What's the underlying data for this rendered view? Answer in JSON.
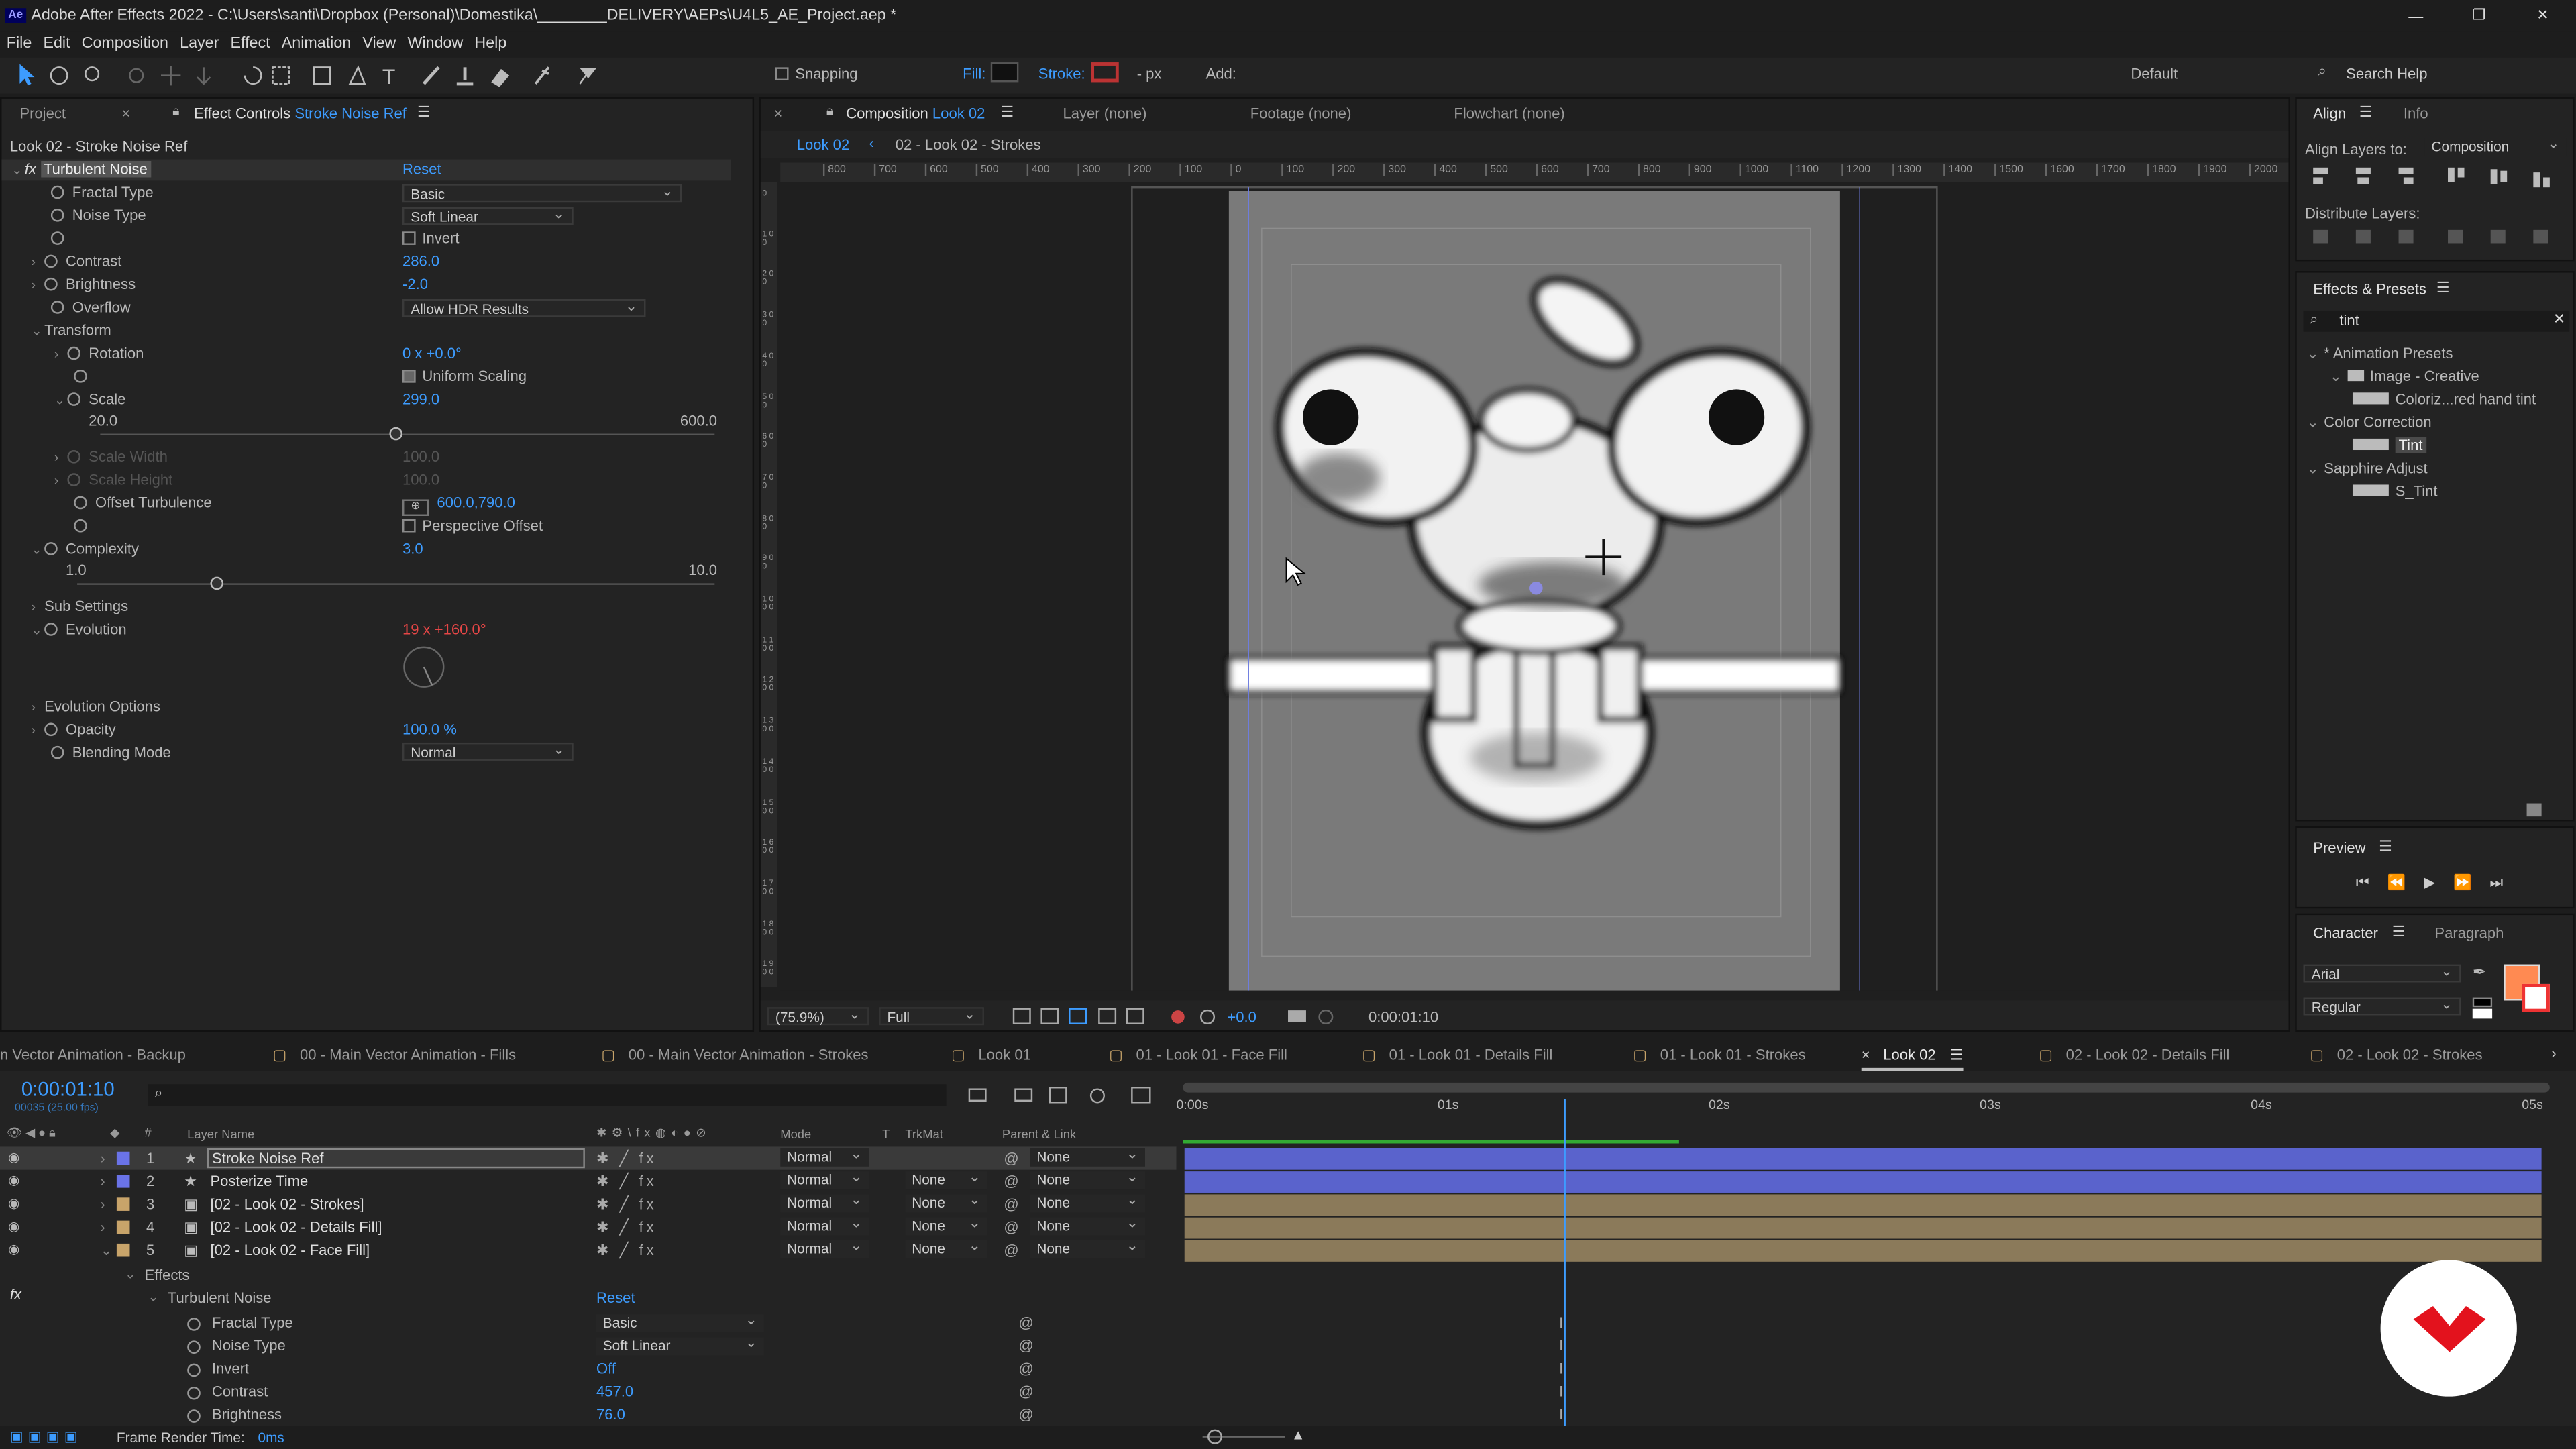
{
  "window": {
    "title": "Adobe After Effects 2022 - C:\\Users\\santi\\Dropbox (Personal)\\Domestika\\________DELIVERY\\AEPs\\U4L5_AE_Project.aep *",
    "logo": "Ae",
    "controls": [
      "—",
      "❐",
      "✕"
    ]
  },
  "menu": [
    "File",
    "Edit",
    "Composition",
    "Layer",
    "Effect",
    "Animation",
    "View",
    "Window",
    "Help"
  ],
  "toolbar": {
    "snapping": "Snapping",
    "fill": "Fill:",
    "stroke": "Stroke:",
    "px": "- px",
    "add": "Add:",
    "workspace": "Default",
    "search": "Search Help"
  },
  "left_panel": {
    "tabs": [
      "Project",
      "Effect Controls"
    ],
    "tab_layer": "Stroke Noise Ref",
    "subtitle": "Look 02 - Stroke Noise Ref",
    "effect_name": "Turbulent Noise",
    "reset": "Reset",
    "props": {
      "fractal_type": {
        "label": "Fractal Type",
        "value": "Basic"
      },
      "noise_type": {
        "label": "Noise Type",
        "value": "Soft Linear"
      },
      "invert": "Invert",
      "contrast": {
        "label": "Contrast",
        "value": "286.0"
      },
      "brightness": {
        "label": "Brightness",
        "value": "-2.0"
      },
      "overflow": {
        "label": "Overflow",
        "value": "Allow HDR Results"
      },
      "transform": "Transform",
      "rotation": {
        "label": "Rotation",
        "value": "0 x +0.0°"
      },
      "uniform": "Uniform Scaling",
      "scale": {
        "label": "Scale",
        "value": "299.0",
        "min": "20.0",
        "max": "600.0",
        "fraction": 0.48
      },
      "scale_w": {
        "label": "Scale Width",
        "value": "100.0"
      },
      "scale_h": {
        "label": "Scale Height",
        "value": "100.0"
      },
      "offset": {
        "label": "Offset Turbulence",
        "value": "600.0,790.0"
      },
      "perspective": "Perspective Offset",
      "complexity": {
        "label": "Complexity",
        "value": "3.0",
        "min": "1.0",
        "max": "10.0",
        "fraction": 0.22
      },
      "sub": "Sub Settings",
      "evolution": {
        "label": "Evolution",
        "value": "19 x +160.0°"
      },
      "evo_opts": "Evolution Options",
      "opacity": {
        "label": "Opacity",
        "value": "100.0 %"
      },
      "blend": {
        "label": "Blending Mode",
        "value": "Normal"
      }
    }
  },
  "comp_panel": {
    "tab": "Composition",
    "tab_name": "Look 02",
    "layer": "Layer  (none)",
    "footage": "Footage  (none)",
    "flowchart": "Flowchart  (none)",
    "crumbs": [
      "Look 02",
      "02 - Look 02 - Strokes"
    ],
    "ruler_h": [
      "800",
      "700",
      "600",
      "500",
      "400",
      "300",
      "200",
      "100",
      "0",
      "100",
      "200",
      "300",
      "400",
      "500",
      "600",
      "700",
      "800",
      "900",
      "1000",
      "1100",
      "1200",
      "1300",
      "1400",
      "1500",
      "1600",
      "1700",
      "1800",
      "1900",
      "2000"
    ],
    "ruler_v": [
      "0",
      "1 0 0",
      "2 0 0",
      "3 0 0",
      "4 0 0",
      "5 0 0",
      "6 0 0",
      "7 0 0",
      "8 0 0",
      "9 0 0",
      "1 0 0 0",
      "1 1 0 0",
      "1 2 0 0",
      "1 3 0 0",
      "1 4 0 0",
      "1 5 0 0",
      "1 6 0 0",
      "1 7 0 0",
      "1 8 0 0",
      "1 9 0 0"
    ],
    "zoom": "(75.9%)",
    "quality": "Full",
    "exposure": "+0.0",
    "time": "0:00:01:10"
  },
  "right_panel": {
    "align": "Align",
    "info": "Info",
    "align_to": "Align Layers to:",
    "align_target": "Composition",
    "distribute": "Distribute Layers:",
    "effects": "Effects & Presets",
    "search": "tint",
    "tree": [
      {
        "label": "* Animation Presets",
        "indent": 0,
        "arrow": "v"
      },
      {
        "label": "Image - Creative",
        "indent": 1,
        "arrow": "v"
      },
      {
        "label": "Coloriz...red hand tint",
        "indent": 2,
        "arrow": ""
      },
      {
        "label": "Color Correction",
        "indent": 0,
        "arrow": "v"
      },
      {
        "label": "Tint",
        "indent": 2,
        "arrow": "",
        "hl": true
      },
      {
        "label": "Sapphire Adjust",
        "indent": 0,
        "arrow": "v"
      },
      {
        "label": "S_Tint",
        "indent": 2,
        "arrow": ""
      }
    ],
    "preview": "Preview",
    "character": "Character",
    "paragraph": "Paragraph",
    "font": "Arial",
    "style": "Regular",
    "fill_color": "#ff8a52"
  },
  "timeline": {
    "tabs": [
      "n Vector Animation - Backup",
      "00 - Main Vector Animation - Fills",
      "00 - Main Vector Animation - Strokes",
      "Look 01",
      "01 - Look 01 - Face Fill",
      "01 - Look 01 - Details Fill",
      "01 - Look 01 - Strokes",
      "Look 02",
      "02 - Look 02 - Details Fill",
      "02 - Look 02 - Strokes"
    ],
    "timecode": "0:00:01:10",
    "frames": "00035 (25.00 fps)",
    "cols": {
      "name": "Layer Name",
      "mode": "Mode",
      "t": "T",
      "trkmat": "TrkMat",
      "parent": "Parent & Link"
    },
    "ruler": [
      "0:00s",
      "01s",
      "02s",
      "03s",
      "04s",
      "05s"
    ],
    "layers": [
      {
        "num": "1",
        "name": "Stroke Noise Ref",
        "mode": "Normal",
        "trk": "",
        "parent": "None",
        "color": "#6a73e8",
        "bar": "#5a63cc",
        "sel": true,
        "star": true
      },
      {
        "num": "2",
        "name": "Posterize Time",
        "mode": "Normal",
        "trk": "None",
        "parent": "None",
        "color": "#6a73e8",
        "bar": "#5a63cc",
        "sel": false,
        "star": true
      },
      {
        "num": "3",
        "name": "[02 - Look 02 - Strokes]",
        "mode": "Normal",
        "trk": "None",
        "parent": "None",
        "color": "#c8a46a",
        "bar": "#8b7a5a",
        "sel": false,
        "star": false
      },
      {
        "num": "4",
        "name": "[02 - Look 02 - Details Fill]",
        "mode": "Normal",
        "trk": "None",
        "parent": "None",
        "color": "#c8a46a",
        "bar": "#8b7a5a",
        "sel": false,
        "star": false
      },
      {
        "num": "5",
        "name": "[02 - Look 02 - Face Fill]",
        "mode": "Normal",
        "trk": "None",
        "parent": "None",
        "color": "#c8a46a",
        "bar": "#8b7a5a",
        "sel": false,
        "star": false
      }
    ],
    "sub": {
      "effects": "Effects",
      "noise": "Turbulent Noise",
      "reset": "Reset",
      "props": [
        {
          "label": "Fractal Type",
          "value": "Basic",
          "dd": true
        },
        {
          "label": "Noise Type",
          "value": "Soft Linear",
          "dd": true
        },
        {
          "label": "Invert",
          "value": "Off",
          "dd": false
        },
        {
          "label": "Contrast",
          "value": "457.0",
          "dd": false
        },
        {
          "label": "Brightness",
          "value": "76.0",
          "dd": false
        }
      ]
    },
    "status": "Frame Render Time:",
    "render_ms": "0ms"
  }
}
